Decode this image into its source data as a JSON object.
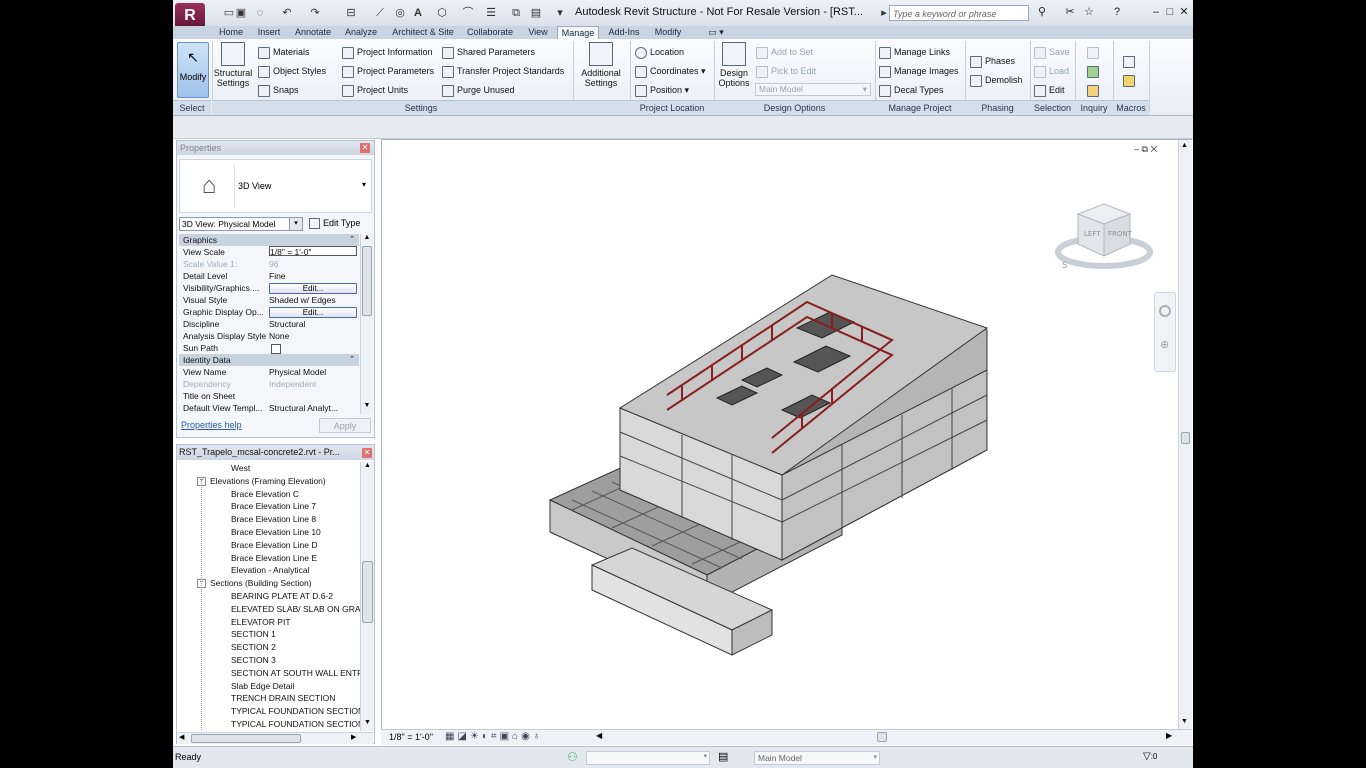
{
  "window": {
    "title": "Autodesk Revit Structure - Not For Resale Version - [RST...",
    "search_placeholder": "Type a keyword or phrase",
    "logo_letter": "R"
  },
  "tabs": [
    "Home",
    "Insert",
    "Annotate",
    "Analyze",
    "Architect & Site",
    "Collaborate",
    "View",
    "Manage",
    "Add-Ins",
    "Modify"
  ],
  "active_tab": "Manage",
  "ribbon": {
    "select": {
      "modify": "Modify",
      "panel": "Select"
    },
    "settings": {
      "structural_settings": "Structural Settings",
      "materials": "Materials",
      "object_styles": "Object Styles",
      "snaps": "Snaps",
      "project_information": "Project Information",
      "project_parameters": "Project Parameters",
      "project_units": "Project Units",
      "shared_parameters": "Shared Parameters",
      "transfer_project_standards": "Transfer Project Standards",
      "purge_unused": "Purge Unused",
      "additional_settings": "Additional Settings",
      "panel": "Settings"
    },
    "project_location": {
      "location": "Location",
      "coordinates": "Coordinates",
      "position": "Position",
      "panel": "Project Location"
    },
    "design_options": {
      "design_options": "Design Options",
      "add_to_set": "Add to Set",
      "pick_to_edit": "Pick to Edit",
      "main_model": "Main Model",
      "panel": "Design Options"
    },
    "manage_project": {
      "manage_links": "Manage Links",
      "manage_images": "Manage Images",
      "decal_types": "Decal Types",
      "panel": "Manage Project"
    },
    "phasing": {
      "phases": "Phases",
      "demolish": "Demolish",
      "panel": "Phasing"
    },
    "selection": {
      "save": "Save",
      "load": "Load",
      "edit": "Edit",
      "panel": "Selection"
    },
    "inquiry": {
      "panel": "Inquiry"
    },
    "macros": {
      "panel": "Macros"
    }
  },
  "properties": {
    "title": "Properties",
    "type_name": "3D View",
    "instance_selector": "3D View: Physical Model",
    "edit_type": "Edit Type",
    "rows": [
      {
        "k": "Graphics",
        "group": true
      },
      {
        "k": "View Scale",
        "v": "1/8\" = 1'-0\""
      },
      {
        "k": "Scale Value    1:",
        "v": "96",
        "dis": true
      },
      {
        "k": "Detail Level",
        "v": "Fine"
      },
      {
        "k": "Visibility/Graphics ...",
        "btn": "Edit..."
      },
      {
        "k": "Visual Style",
        "v": "Shaded w/ Edges"
      },
      {
        "k": "Graphic Display Op...",
        "btn": "Edit..."
      },
      {
        "k": "Discipline",
        "v": "Structural"
      },
      {
        "k": "Analysis Display Style",
        "v": "None"
      },
      {
        "k": "Sun Path",
        "check": true
      },
      {
        "k": "Identity Data",
        "group": true
      },
      {
        "k": "View Name",
        "v": "Physical Model"
      },
      {
        "k": "Dependency",
        "v": "Independent",
        "dis": true
      },
      {
        "k": "Title on Sheet",
        "v": ""
      },
      {
        "k": "Default View Templ...",
        "v": "Structural Analyt..."
      }
    ],
    "help_link": "Properties help",
    "apply": "Apply"
  },
  "browser": {
    "title": "RST_Trapelo_mcsal-concrete2.rvt - Pr...",
    "items": [
      {
        "t": "West",
        "lvl": 2
      },
      {
        "t": "Elevations (Framing Elevation)",
        "lvl": 1,
        "exp": "−"
      },
      {
        "t": "Brace Elevation C",
        "lvl": 2
      },
      {
        "t": "Brace Elevation Line 7",
        "lvl": 2
      },
      {
        "t": "Brace Elevation Line 8",
        "lvl": 2
      },
      {
        "t": "Brace Elevation Line 10",
        "lvl": 2
      },
      {
        "t": "Brace Elevation Line D",
        "lvl": 2
      },
      {
        "t": "Brace Elevation Line E",
        "lvl": 2
      },
      {
        "t": "Elevation - Analytical",
        "lvl": 2
      },
      {
        "t": "Sections (Building Section)",
        "lvl": 1,
        "exp": "−"
      },
      {
        "t": "BEARING PLATE AT D.6-2",
        "lvl": 2
      },
      {
        "t": "ELEVATED SLAB/ SLAB ON GRAI",
        "lvl": 2
      },
      {
        "t": "ELEVATOR PIT",
        "lvl": 2
      },
      {
        "t": "SECTION 1",
        "lvl": 2
      },
      {
        "t": "SECTION 2",
        "lvl": 2
      },
      {
        "t": "SECTION 3",
        "lvl": 2
      },
      {
        "t": "SECTION AT SOUTH WALL ENTR",
        "lvl": 2
      },
      {
        "t": "Slab Edge Detail",
        "lvl": 2
      },
      {
        "t": "TRENCH DRAIN SECTION",
        "lvl": 2
      },
      {
        "t": "TYPICAL FOUNDATION SECTION",
        "lvl": 2
      },
      {
        "t": "TYPICAL FOUNDATION SECTION",
        "lvl": 2
      }
    ]
  },
  "viewcube": {
    "left": "LEFT",
    "front": "FRONT",
    "south": "S"
  },
  "view_control_bar": {
    "scale": "1/8\" = 1'-0\""
  },
  "status_bar": {
    "text": "Ready",
    "model": "Main Model",
    "filter_count": ":0"
  }
}
